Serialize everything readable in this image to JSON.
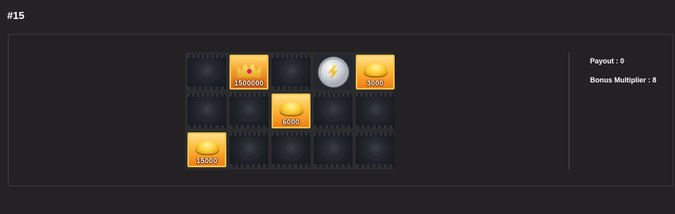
{
  "round": {
    "title": "#15"
  },
  "grid": {
    "rows": [
      [
        {
          "kind": "blank"
        },
        {
          "kind": "prize",
          "icon": "crown-icon",
          "amount": "1500000"
        },
        {
          "kind": "blank"
        },
        {
          "kind": "emblem",
          "icon": "silver-coin-icon"
        },
        {
          "kind": "prize",
          "icon": "gold-pile-icon",
          "amount": "3000"
        }
      ],
      [
        {
          "kind": "blank"
        },
        {
          "kind": "blank"
        },
        {
          "kind": "prize",
          "icon": "gold-pile-icon",
          "amount": "6000"
        },
        {
          "kind": "blank"
        },
        {
          "kind": "blank"
        }
      ],
      [
        {
          "kind": "prize",
          "icon": "gold-pile-icon",
          "amount": "15000"
        },
        {
          "kind": "blank"
        },
        {
          "kind": "blank"
        },
        {
          "kind": "blank"
        },
        {
          "kind": "blank"
        }
      ]
    ]
  },
  "summary": {
    "payout": "Payout : 0",
    "bonus_multiplier": "Bonus Multiplier : 8"
  },
  "colors": {
    "background": "#242225",
    "panel_border": "#3b393c",
    "prize_gold": "#ffb83a"
  }
}
